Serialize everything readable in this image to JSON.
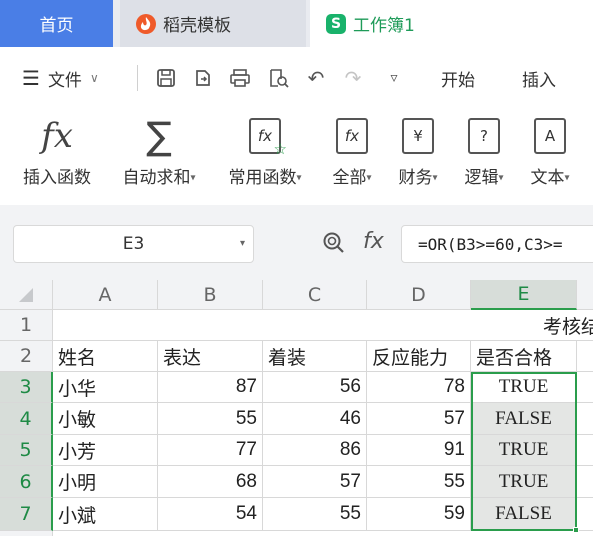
{
  "tabs": {
    "home": "首页",
    "template": "稻壳模板",
    "workbook": "工作簿1"
  },
  "menu": {
    "file": "文件",
    "start": "开始",
    "insert": "插入"
  },
  "ribbon": [
    {
      "label": "插入函数",
      "icon": "fx-icon",
      "has_arrow": false
    },
    {
      "label": "自动求和",
      "icon": "sigma-icon",
      "has_arrow": true
    },
    {
      "label": "常用函数",
      "icon": "star-function-icon",
      "has_arrow": true
    },
    {
      "label": "全部",
      "icon": "all-functions-icon",
      "has_arrow": true
    },
    {
      "label": "财务",
      "icon": "finance-book-icon",
      "has_arrow": true
    },
    {
      "label": "逻辑",
      "icon": "logic-book-icon",
      "has_arrow": true
    },
    {
      "label": "文本",
      "icon": "text-book-icon",
      "has_arrow": true
    }
  ],
  "formula_bar": {
    "cell_ref": "E3",
    "formula": "=OR(B3>=60,C3>="
  },
  "sheet": {
    "columns": [
      "A",
      "B",
      "C",
      "D",
      "E"
    ],
    "selected_column": "E",
    "row_numbers": [
      "1",
      "2",
      "3",
      "4",
      "5",
      "6",
      "7"
    ],
    "title_text": "考核结",
    "headers": [
      "姓名",
      "表达",
      "着装",
      "反应能力",
      "是否合格"
    ],
    "rows": [
      {
        "name": "小华",
        "b": "87",
        "c": "56",
        "d": "78",
        "e": "TRUE"
      },
      {
        "name": "小敏",
        "b": "55",
        "c": "46",
        "d": "57",
        "e": "FALSE"
      },
      {
        "name": "小芳",
        "b": "77",
        "c": "86",
        "d": "91",
        "e": "TRUE"
      },
      {
        "name": "小明",
        "b": "68",
        "c": "57",
        "d": "55",
        "e": "TRUE"
      },
      {
        "name": "小斌",
        "b": "54",
        "c": "55",
        "d": "59",
        "e": "FALSE"
      }
    ]
  },
  "colors": {
    "accent_blue": "#4a7ee6",
    "sheet_green": "#2a9d4c"
  }
}
